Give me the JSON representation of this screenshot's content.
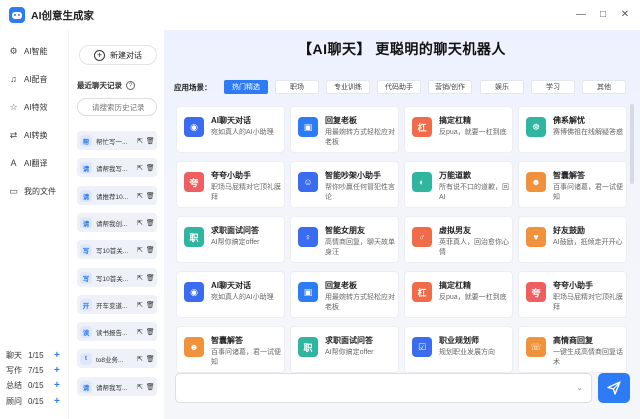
{
  "app": {
    "title": "AI创意生成家"
  },
  "window_controls": {
    "minimize": "—",
    "maximize": "□",
    "close": "✕"
  },
  "nav": [
    {
      "label": "AI智能",
      "icon": "robot-icon",
      "glyph": "⚙"
    },
    {
      "label": "AI配音",
      "icon": "audio-icon",
      "glyph": "♫"
    },
    {
      "label": "AI特效",
      "icon": "magic-icon",
      "glyph": "☆"
    },
    {
      "label": "AI转换",
      "icon": "convert-icon",
      "glyph": "⇄"
    },
    {
      "label": "AI翻译",
      "icon": "translate-icon",
      "glyph": "A"
    },
    {
      "label": "我的文件",
      "icon": "folder-icon",
      "glyph": "▭"
    }
  ],
  "quotas": [
    {
      "label": "聊天",
      "value": "1/15",
      "plus": "+"
    },
    {
      "label": "写作",
      "value": "7/15",
      "plus": "+"
    },
    {
      "label": "总结",
      "value": "0/15",
      "plus": "+"
    },
    {
      "label": "顾问",
      "value": "0/15",
      "plus": "+"
    }
  ],
  "history": {
    "new_chat_label": "新建对话",
    "title": "最近聊天记录",
    "help": "?",
    "search_placeholder": "请搜索历史记录",
    "items": [
      {
        "badge": "帮",
        "text": "帮忙写一..."
      },
      {
        "badge": "请",
        "text": "请帮我写..."
      },
      {
        "badge": "请",
        "text": "请推荐10..."
      },
      {
        "badge": "请",
        "text": "请帮我创..."
      },
      {
        "badge": "写",
        "text": "写10首关..."
      },
      {
        "badge": "写",
        "text": "写10首关..."
      },
      {
        "badge": "开",
        "text": "开车变道..."
      },
      {
        "badge": "读",
        "text": "读书报告..."
      },
      {
        "badge": "t",
        "text": "to8业务..."
      },
      {
        "badge": "请",
        "text": "请帮我写..."
      }
    ]
  },
  "main": {
    "title": "【AI聊天】 更聪明的聊天机器人",
    "scene_label": "应用场景：",
    "tabs": [
      "热门精选",
      "职场",
      "专业训练",
      "代码助手",
      "营销/创作",
      "娱乐",
      "学习",
      "其他"
    ],
    "cards": [
      {
        "title": "AI聊天对话",
        "desc": "宛如真人的AI小助理",
        "color": "#3b6cf0",
        "glyph": "◉"
      },
      {
        "title": "回复老板",
        "desc": "用最婉转方式轻松应对老板",
        "color": "#2d7bf5",
        "glyph": "▣"
      },
      {
        "title": "搞定杠精",
        "desc": "反pua，就要一杠到底",
        "color": "#f06b4a",
        "glyph": "杠"
      },
      {
        "title": "佛系解忧",
        "desc": "赛博佛祖在线解疑答惑",
        "color": "#2fb5a0",
        "glyph": "☸"
      },
      {
        "title": "夸夸小助手",
        "desc": "职场马屁精对它顶礼膜拜",
        "color": "#f05f5f",
        "glyph": "夸"
      },
      {
        "title": "智能吵架小助手",
        "desc": "帮你吵赢任何冒犯性言论",
        "color": "#3b6cf0",
        "glyph": "☺"
      },
      {
        "title": "万能道歉",
        "desc": "所有说不口的道歉，回AI",
        "color": "#2fb5a0",
        "glyph": "◐"
      },
      {
        "title": "智囊解答",
        "desc": "百事问诸葛，君一试便知",
        "color": "#f0913b",
        "glyph": "☻"
      },
      {
        "title": "求职面试问答",
        "desc": "AI帮你搞定offer",
        "color": "#2fb5a0",
        "glyph": "职"
      },
      {
        "title": "智能女朋友",
        "desc": "高情商回复，聊天故单身汪",
        "color": "#3b6cf0",
        "glyph": "♀"
      },
      {
        "title": "虚拟男友",
        "desc": "英菲真人，回治愈你心情",
        "color": "#f06b4a",
        "glyph": "♂"
      },
      {
        "title": "好友鼓励",
        "desc": "AI鼓励，抵倾走开开心",
        "color": "#f0913b",
        "glyph": "♥"
      },
      {
        "title": "AI聊天对话",
        "desc": "宛如真人的AI小助理",
        "color": "#3b6cf0",
        "glyph": "◉"
      },
      {
        "title": "回复老板",
        "desc": "用最婉转方式轻松应对老板",
        "color": "#2d7bf5",
        "glyph": "▣"
      },
      {
        "title": "搞定杠精",
        "desc": "反pua，就要一杠到底",
        "color": "#f06b4a",
        "glyph": "杠"
      },
      {
        "title": "夸夸小助手",
        "desc": "职场马屁精对它顶礼膜拜",
        "color": "#f05f5f",
        "glyph": "夸"
      },
      {
        "title": "智囊解答",
        "desc": "百事问诸葛，君一试便知",
        "color": "#f0913b",
        "glyph": "☻"
      },
      {
        "title": "求职面试问答",
        "desc": "AI帮你搞定offer",
        "color": "#2fb5a0",
        "glyph": "职"
      },
      {
        "title": "职业规划师",
        "desc": "规划职业发展方向",
        "color": "#3b6cf0",
        "glyph": "☑"
      },
      {
        "title": "高情商回复",
        "desc": "一键生成高情商回复话术",
        "color": "#f0913b",
        "glyph": "☏"
      }
    ]
  }
}
